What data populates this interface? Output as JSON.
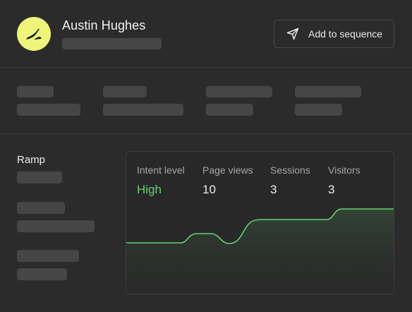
{
  "header": {
    "name": "Austin Hughes",
    "logo_icon": "ramp-logo-icon",
    "avatar_color": "#eef57a",
    "action_button": {
      "label": "Add to sequence",
      "icon": "send-icon"
    }
  },
  "company": {
    "name": "Ramp"
  },
  "metrics": [
    {
      "label": "Intent level",
      "value": "High"
    },
    {
      "label": "Page views",
      "value": "10"
    },
    {
      "label": "Sessions",
      "value": "3"
    },
    {
      "label": "Visitors",
      "value": "3"
    }
  ],
  "colors": {
    "accent_green": "#62d26f",
    "background": "#2b2b2b",
    "skeleton": "#464646"
  }
}
